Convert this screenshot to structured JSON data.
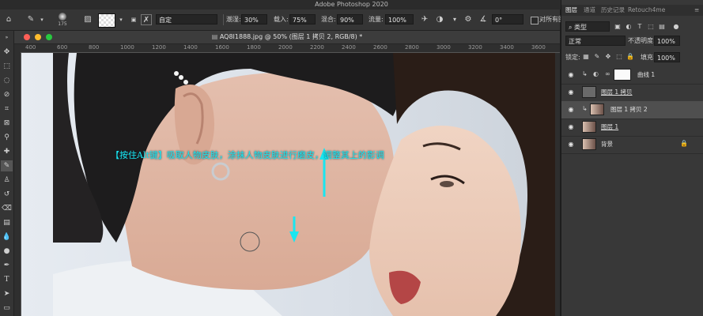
{
  "app": {
    "title": "Adobe Photoshop 2020"
  },
  "options_bar": {
    "brush_size": "175",
    "mode_value": "自定",
    "smudge_label": "潮湿:",
    "smudge_value": "30%",
    "load_label": "载入:",
    "load_value": "75%",
    "mix_label": "混合:",
    "mix_value": "90%",
    "flow_label": "流量:",
    "flow_value": "100%",
    "angle_value": "0°",
    "sample_all_label": "对所有图"
  },
  "document": {
    "tab_title": "AQ8I1888.jpg @ 50% (图层 1 拷贝 2, RGB/8) *",
    "ruler_ticks": [
      "400",
      "600",
      "800",
      "1000",
      "1200",
      "1400",
      "1600",
      "1800",
      "2000",
      "2200",
      "2400",
      "2600",
      "2800",
      "3000",
      "3200",
      "3400",
      "3600"
    ]
  },
  "annotation": {
    "text": "【按住Alt键】吸取人物皮肤，涂抹人物皮肤进行磨皮，调整其上的影调",
    "color": "#19e6f0"
  },
  "layers_panel": {
    "tabs": [
      "图层",
      "通道",
      "历史记录",
      "Retouch4me"
    ],
    "filter_value": "类型",
    "blend_mode": "正常",
    "opacity_label": "不透明度:",
    "opacity_value": "100%",
    "lock_label": "锁定:",
    "fill_label": "填充:",
    "fill_value": "100%",
    "layers": [
      {
        "name": "曲线 1",
        "selected": false,
        "linked": false
      },
      {
        "name": "图层 1 拷贝",
        "selected": false,
        "linked": true
      },
      {
        "name": "图层 1 拷贝 2",
        "selected": true,
        "linked": false
      },
      {
        "name": "图层 1",
        "selected": false,
        "linked": true
      },
      {
        "name": "背景",
        "selected": false,
        "linked": false
      }
    ]
  },
  "colors": {
    "accent_annotation": "#19e6f0",
    "panel_bg": "#383838",
    "selected_layer": "#4f4f4f"
  }
}
